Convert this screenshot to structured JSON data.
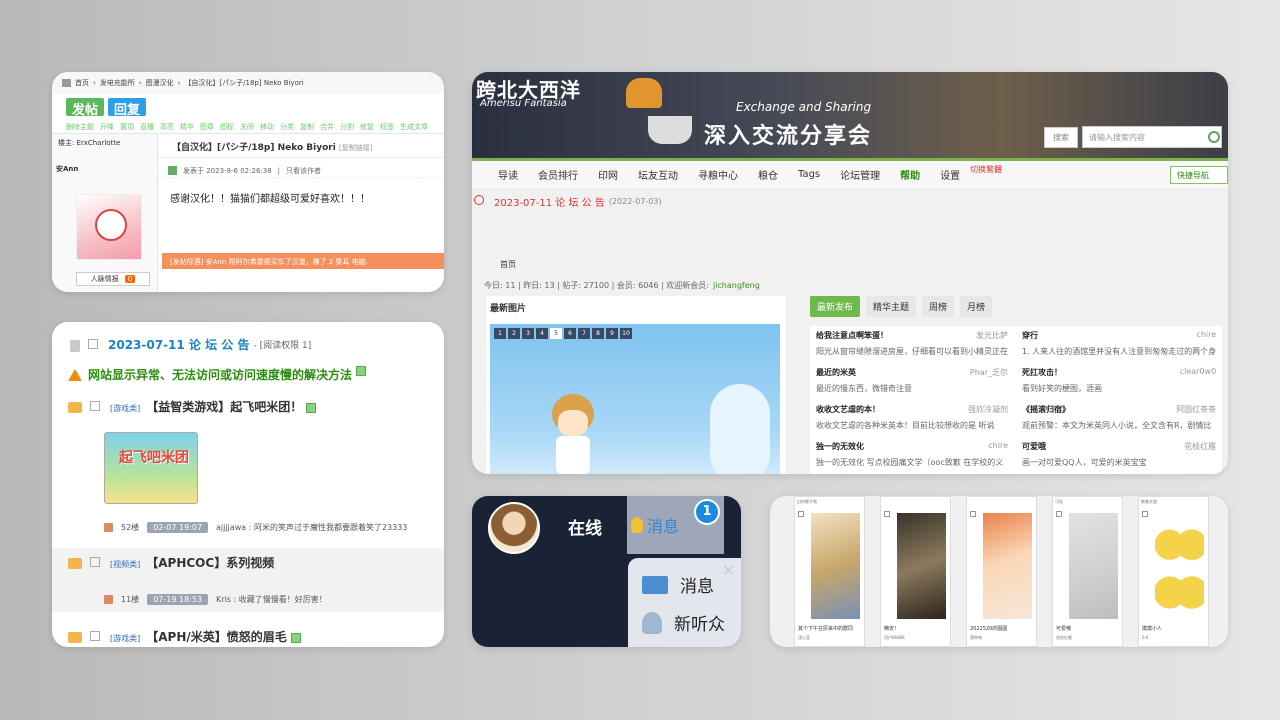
{
  "panelA": {
    "breadcrumb": [
      "首页",
      "发电充能所",
      "图漫汉化",
      "【自汉化】[パシ子/18p] Neko Biyori"
    ],
    "post_btn": "发帖",
    "reply_btn": "回复",
    "mod_actions": [
      "删除主题",
      "升降",
      "置顶",
      "直播",
      "高亮",
      "精华",
      "图章",
      "图标",
      "关闭",
      "移动",
      "分类",
      "复制",
      "合并",
      "分割",
      "修复",
      "标签",
      "生成文章"
    ],
    "op_label": "楼主: ErxCharlotte",
    "thread_title": "【自汉化】[パシ子/18p] Neko Biyori",
    "copy_link": "[复制链接]",
    "user": "安Ann",
    "post_meta": "发表于 2023-8-6 02:26:38",
    "only_author": "只看该作者",
    "post_body": "感谢汉化！！猫猫们都超级可爱好喜欢！！！",
    "warn_text": "[发帖际遇] 安Ann 帮阿尔弗雷德买车了汉堡，赚了 2 集耳 电脑.",
    "relation": "人脉情报",
    "relation_count": "0"
  },
  "panelB": {
    "announcement": "2023-07-11 论 坛 公 告",
    "announce_perm": "- [阅读权限 1]",
    "solution": "网站显示异常、无法访问或访问速度慢的解决方法",
    "t1_cat": "[游戏类]",
    "t1_title": "【益智类游戏】起飞吧米团！",
    "t1_img_text": "起飞吧米团",
    "t1_replies": "52楼",
    "t1_date": "02-07 19:07",
    "t1_last": "ajjjjawa : 阿米的笑声过于魔性我都要跟着笑了23333",
    "t2_cat": "[视频类]",
    "t2_title": "【APHCOC】系列视频",
    "t2_replies": "11楼",
    "t2_date": "07-19 18:53",
    "t2_last": "Kris : 收藏了慢慢看！好厉害！",
    "t3_cat": "[游戏类]",
    "t3_title": "【APH/米英】愤怒的眉毛"
  },
  "panelC": {
    "logo": "跨北大西洋",
    "logo_sub": "Amerisu Fantasia",
    "exchange": "Exchange and Sharing",
    "slogan": "深入交流分享会",
    "search_label": "搜索",
    "search_placeholder": "请输入搜索内容",
    "nav": [
      "导读",
      "会员排行",
      "印网",
      "坛友互动",
      "寻粮中心",
      "粮仓",
      "Tags",
      "论坛管理",
      "帮助",
      "设置"
    ],
    "nav_active": "帮助",
    "switch_style": "切换繁體",
    "quick_nav": "快捷导航",
    "notice": "2023-07-11 论 坛 公 告",
    "notice_date": "(2022-07-03)",
    "crumb": "首页",
    "stats": "今日: 11 | 昨日: 13 | 帖子: 27100 | 会员: 6046 | 欢迎新会员: ",
    "new_member": "jichangfeng",
    "latest_images": "最新图片",
    "pager": [
      "1",
      "2",
      "3",
      "4",
      "5",
      "6",
      "7",
      "8",
      "9",
      "10"
    ],
    "pager_active": "5",
    "tabs": [
      "最新发布",
      "精华主题",
      "周榜",
      "月榜"
    ],
    "posts": [
      {
        "title": "给我注意点啊笨蛋！",
        "author": "发光比萨",
        "snippet": "阳光从窗帘缝隙溜进房屋，仔细看可以看到小精灵正在"
      },
      {
        "title": "穿行",
        "author": "chire",
        "snippet": "1. 人来人往的酒馆里并没有人注意到匆匆走过的两个身"
      },
      {
        "title": "最近的米英",
        "author": "Phar_乏尔",
        "snippet": "最近的慢东西，微错奇注意"
      },
      {
        "title": "死扛攻击！",
        "author": "clear0w0",
        "snippet": "看到好笑的梗图，涯画"
      },
      {
        "title": "收收文艺虐的本！",
        "author": "强欣冷凝剂",
        "snippet": "收收文艺虐的各种米英本！目前比较想收的是 听说"
      },
      {
        "title": "《摇滚归宿》",
        "author": "阿圆红茶茶",
        "snippet": "观前预警：本文为米英同人小说，全文含有R，剧情比"
      },
      {
        "title": "独一的无效化",
        "author": "chire",
        "snippet": "独一的无效化 写点校园痛文学（ooc致歉 在学校的义"
      },
      {
        "title": "可爱哦",
        "author": "花枝红雁",
        "snippet": "画一对可爱QQ人，可爱的米英宝宝"
      }
    ]
  },
  "panelD": {
    "online": "在线",
    "messages_tab": "消息",
    "badge": "1",
    "menu": [
      "消息",
      "新听众"
    ],
    "close": "×"
  },
  "panelE": {
    "cards": [
      {
        "top": "旧的梗子格",
        "cap": "其个下午在原来中的群同",
        "sub": "湮心蓝"
      },
      {
        "top": "",
        "cap": "精安！",
        "sub": "用户86888"
      },
      {
        "top": "",
        "cap": "2022520的图图",
        "sub": "莫种帝"
      },
      {
        "top": "可现",
        "cap": "可爱哦",
        "sub": "花枝红雁"
      },
      {
        "top": "聚着文楼",
        "cap": "摸摸小人",
        "sub": "B.K"
      }
    ]
  }
}
